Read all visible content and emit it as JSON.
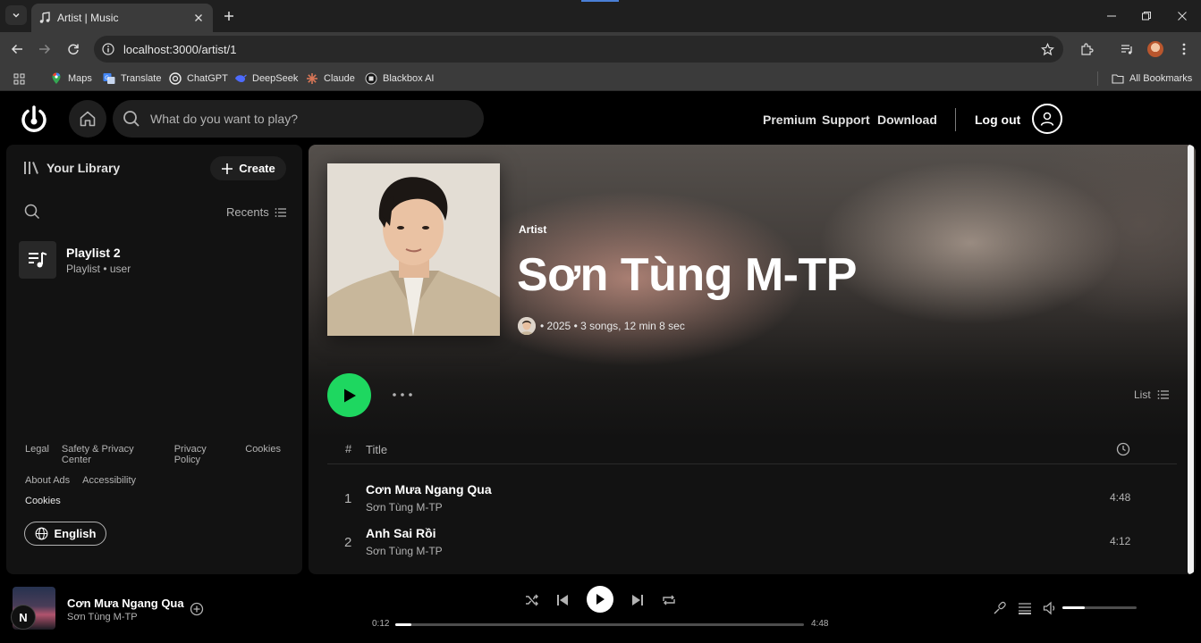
{
  "browser": {
    "tab_title": "Artist | Music",
    "url": "localhost:3000/artist/1",
    "bookmarks": [
      "Maps",
      "Translate",
      "ChatGPT",
      "DeepSeek",
      "Claude",
      "Blackbox AI"
    ],
    "all_bookmarks": "All Bookmarks"
  },
  "header": {
    "search_placeholder": "What do you want to play?",
    "links": [
      "Premium",
      "Support",
      "Download"
    ],
    "logout": "Log out"
  },
  "sidebar": {
    "title": "Your Library",
    "create": "Create",
    "sort": "Recents",
    "items": [
      {
        "name": "Playlist 2",
        "subtitle": "Playlist • user"
      }
    ],
    "footer_row1": [
      "Legal",
      "Safety & Privacy Center",
      "Privacy Policy",
      "Cookies"
    ],
    "footer_row2": [
      "About Ads",
      "Accessibility"
    ],
    "footer_row3": "Cookies",
    "language": "English"
  },
  "artist": {
    "label": "Artist",
    "name": "Sơn Tùng M-TP",
    "meta": "• 2025 • 3 songs, 12 min 8 sec",
    "view_mode": "List"
  },
  "tracks": {
    "header_num": "#",
    "header_title": "Title",
    "rows": [
      {
        "num": "1",
        "title": "Cơn Mưa Ngang Qua",
        "artist": "Sơn Tùng M-TP",
        "duration": "4:48"
      },
      {
        "num": "2",
        "title": "Anh Sai Rồi",
        "artist": "Sơn Tùng M-TP",
        "duration": "4:12"
      }
    ]
  },
  "player": {
    "title": "Cơn Mưa Ngang Qua",
    "artist": "Sơn Tùng M-TP",
    "badge": "N",
    "current_time": "0:12",
    "total_time": "4:48",
    "progress": 0.04,
    "volume": 0.3
  },
  "colors": {
    "accent": "#1ed760",
    "background": "#000000",
    "panel": "#121212"
  }
}
